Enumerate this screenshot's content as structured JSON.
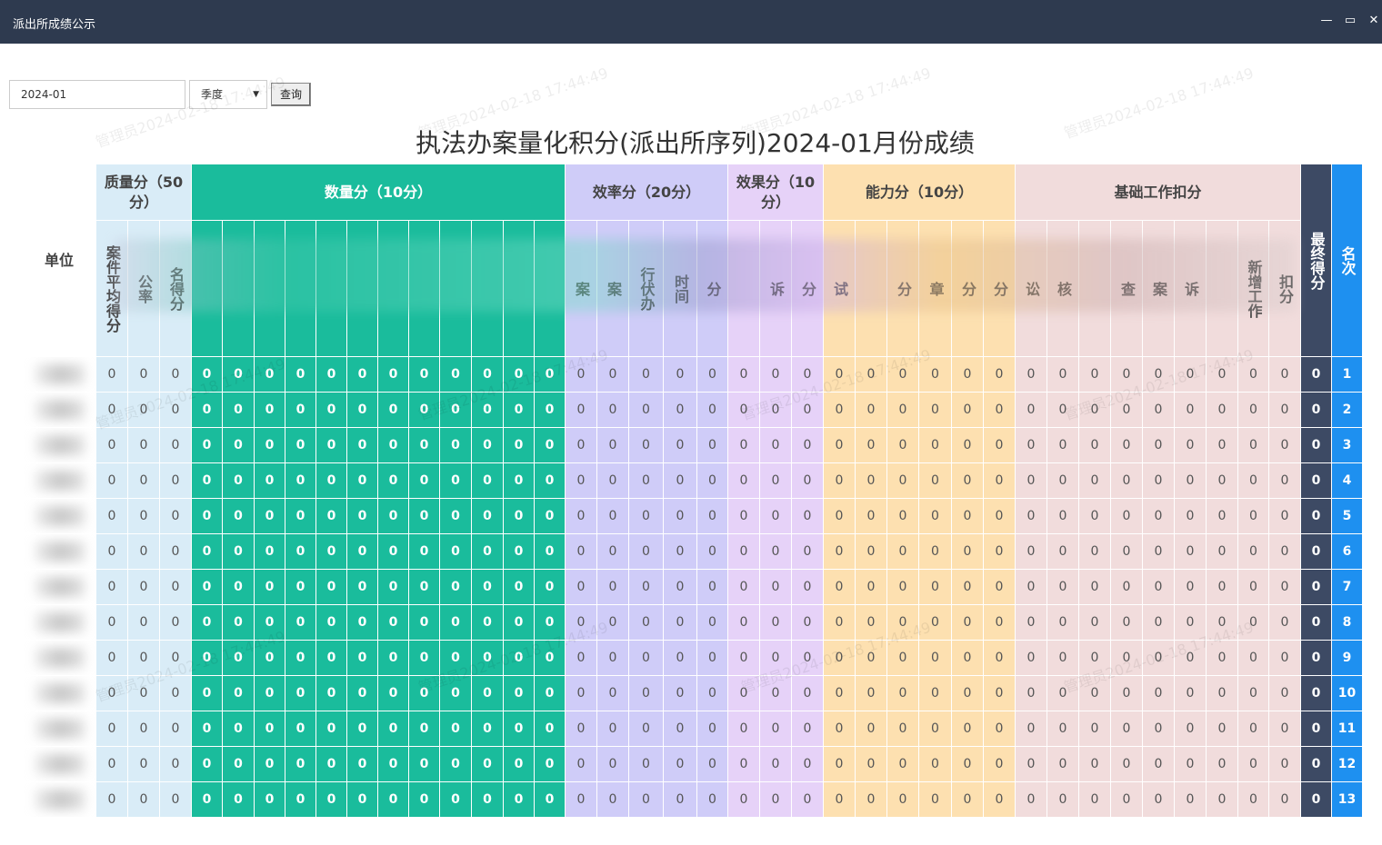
{
  "window": {
    "title": "派出所成绩公示",
    "minimize": "—",
    "restore": "▭",
    "close": "✕"
  },
  "toolbar": {
    "date_value": "2024-01",
    "period_select": "季度",
    "query_label": "查询"
  },
  "watermark_text": "管理员2024-02-18 17:44:49",
  "page_title": "执法办案量化积分(派出所序列)2024-01月份成绩",
  "colors": {
    "unit_bg": "#ffffff",
    "quality_bg": "#d9ecf7",
    "quantity_bg": "#1abc9c",
    "efficiency_bg": "#cfccf8",
    "effect_bg": "#e6d2f8",
    "ability_bg": "#fde0b0",
    "basic_bg": "#f1dcdc",
    "final_bg": "#3d4a64",
    "rank_bg": "#1e90f0"
  },
  "headers": {
    "unit": "单位",
    "quality": "质量分（50分）",
    "quantity": "数量分（10分）",
    "efficiency": "效率分（20分）",
    "effect": "效果分（10分）",
    "ability": "能力分（10分）",
    "basic": "基础工作扣分",
    "final": "最终得分",
    "rank": "名次"
  },
  "subheaders": {
    "quality": [
      "案件平均得分",
      "公率",
      "名得分"
    ],
    "efficiency": [
      "案",
      "案",
      "行伏办",
      "时间",
      "分"
    ],
    "effect": [
      "",
      "诉",
      "分"
    ],
    "ability": [
      "试",
      "",
      "分",
      "章",
      "分",
      "分"
    ],
    "basic": [
      "讼",
      "核",
      "",
      "查",
      "案",
      "诉",
      "",
      "新增工作",
      "扣分"
    ]
  },
  "rows": [
    {
      "rank": "1"
    },
    {
      "rank": "2"
    },
    {
      "rank": "3"
    },
    {
      "rank": "4"
    },
    {
      "rank": "5"
    },
    {
      "rank": "6"
    },
    {
      "rank": "7"
    },
    {
      "rank": "8"
    },
    {
      "rank": "9"
    },
    {
      "rank": "10"
    },
    {
      "rank": "11"
    },
    {
      "rank": "12"
    },
    {
      "rank": "13"
    }
  ],
  "cell_value": "0"
}
